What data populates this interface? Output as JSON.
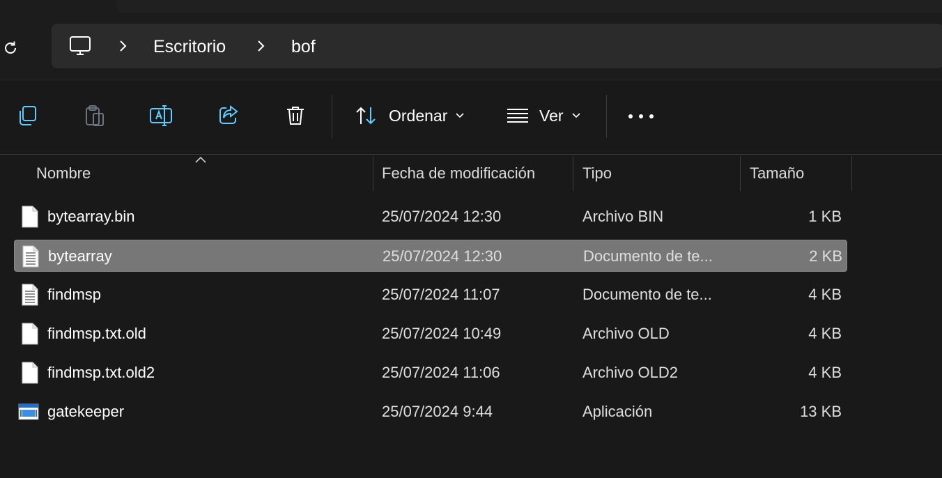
{
  "address": {
    "crumbs": [
      "Escritorio",
      "bof"
    ]
  },
  "toolbar": {
    "sort_label": "Ordenar",
    "view_label": "Ver",
    "icons": [
      "copy-icon",
      "paste-icon",
      "rename-icon",
      "share-icon",
      "delete-icon",
      "sort-icon",
      "view-icon",
      "more-icon"
    ]
  },
  "columns": {
    "name": "Nombre",
    "modified": "Fecha de modificación",
    "type": "Tipo",
    "size": "Tamaño"
  },
  "files": [
    {
      "name": "bytearray.bin",
      "modified": "25/07/2024 12:30",
      "type": "Archivo BIN",
      "size": "1 KB",
      "icon": "blank-file-icon",
      "selected": false
    },
    {
      "name": "bytearray",
      "modified": "25/07/2024 12:30",
      "type": "Documento de te...",
      "size": "2 KB",
      "icon": "text-file-icon",
      "selected": true
    },
    {
      "name": "findmsp",
      "modified": "25/07/2024 11:07",
      "type": "Documento de te...",
      "size": "4 KB",
      "icon": "text-file-icon",
      "selected": false
    },
    {
      "name": "findmsp.txt.old",
      "modified": "25/07/2024 10:49",
      "type": "Archivo OLD",
      "size": "4 KB",
      "icon": "blank-file-icon",
      "selected": false
    },
    {
      "name": "findmsp.txt.old2",
      "modified": "25/07/2024 11:06",
      "type": "Archivo OLD2",
      "size": "4 KB",
      "icon": "blank-file-icon",
      "selected": false
    },
    {
      "name": "gatekeeper",
      "modified": "25/07/2024 9:44",
      "type": "Aplicación",
      "size": "13 KB",
      "icon": "application-icon",
      "selected": false
    }
  ],
  "colors": {
    "background": "#191919",
    "selection": "#777777",
    "accent_icon": "#60cdff"
  }
}
